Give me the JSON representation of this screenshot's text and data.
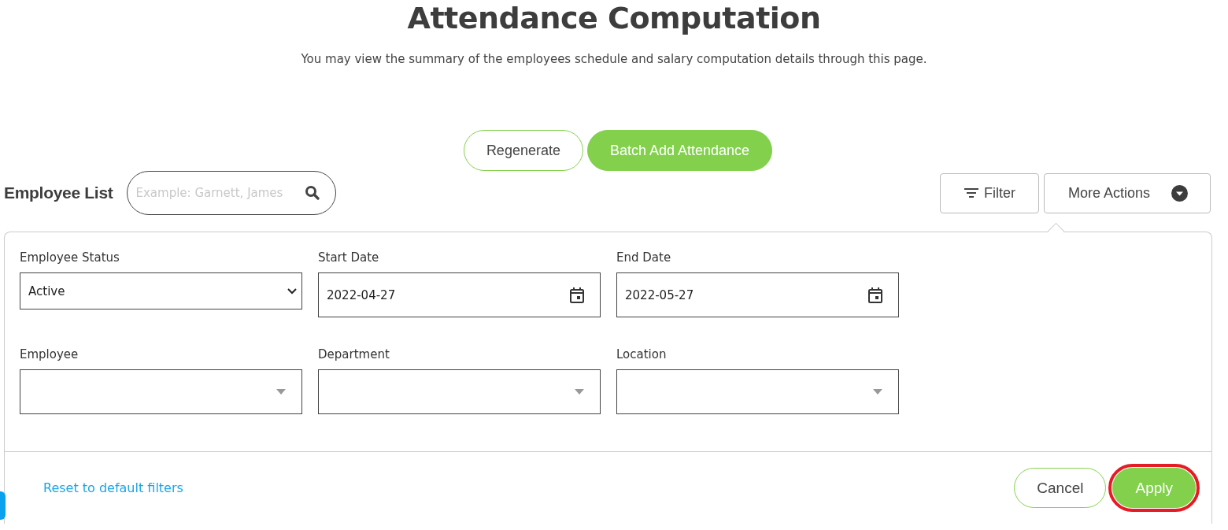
{
  "page": {
    "title": "Attendance Computation",
    "subtitle": "You may view the summary of the employees schedule and salary computation details through this page."
  },
  "actions": [
    {
      "label": "Regenerate",
      "kind": "outline"
    },
    {
      "label": "Batch Add Attendance",
      "kind": "primary"
    }
  ],
  "employee_list": {
    "title": "Employee List",
    "search": {
      "placeholder": "Example: Garnett, James"
    },
    "buttons": [
      {
        "label": "Filter",
        "kind": "filter"
      },
      {
        "label": "More Actions",
        "kind": "menu"
      }
    ]
  },
  "filter_panel": {
    "fields": [
      {
        "label": "Employee Status",
        "kind": "select",
        "value": "Active"
      },
      {
        "label": "Start Date",
        "kind": "date",
        "value": "2022-04-27"
      },
      {
        "label": "End Date",
        "kind": "date",
        "value": "2022-05-27"
      },
      {
        "label": "Employee",
        "kind": "combo"
      },
      {
        "label": "Department",
        "kind": "combo"
      },
      {
        "label": "Location",
        "kind": "combo"
      }
    ],
    "reset_link": "Reset to default filters",
    "buttons": [
      {
        "label": "Cancel",
        "kind": "outline",
        "highlighted": false
      },
      {
        "label": "Apply",
        "kind": "primary",
        "highlighted": true
      }
    ]
  }
}
